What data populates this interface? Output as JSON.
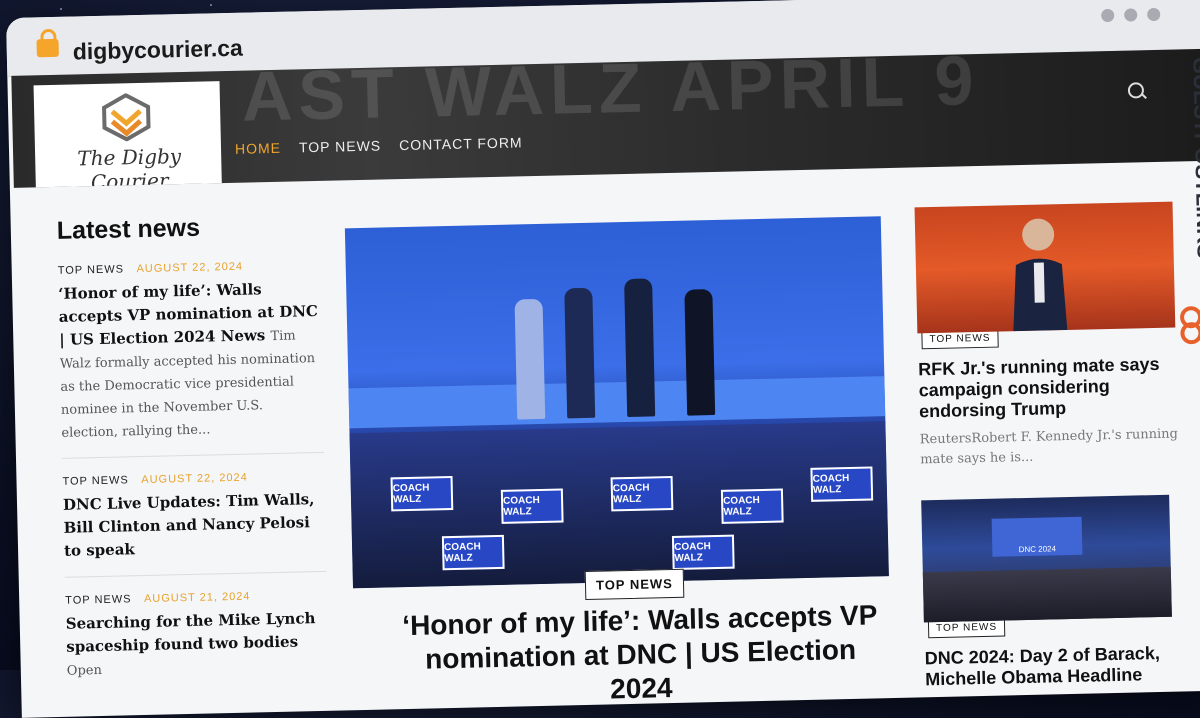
{
  "browser": {
    "url": "digbycourier.ca"
  },
  "header": {
    "logo_text": "The Digby Courier",
    "banner_text": "AST WALZ APRIL 9",
    "nav": [
      {
        "label": "HOME",
        "active": true
      },
      {
        "label": "TOP NEWS",
        "active": false
      },
      {
        "label": "CONTACT FORM",
        "active": false
      }
    ]
  },
  "latest": {
    "title": "Latest news",
    "items": [
      {
        "category": "TOP NEWS",
        "date": "AUGUST 22, 2024",
        "title": "‘Honor of my life’: Walls accepts VP nomination at DNC | US Election 2024 News",
        "excerpt": "Tim Walz formally accepted his nomination as the Democratic vice presidential nominee in the November U.S. election, rallying the..."
      },
      {
        "category": "TOP NEWS",
        "date": "AUGUST 22, 2024",
        "title": "DNC Live Updates: Tim Walls, Bill Clinton and Nancy Pelosi to speak",
        "excerpt": ""
      },
      {
        "category": "TOP NEWS",
        "date": "AUGUST 21, 2024",
        "title": "Searching for the Mike Lynch spaceship found two bodies",
        "excerpt": "Open"
      }
    ]
  },
  "hero": {
    "category": "TOP NEWS",
    "title": "‘Honor of my life’: Walls accepts VP nomination at DNC | US Election 2024",
    "sign_text": "COACH WALZ"
  },
  "side": [
    {
      "category": "TOP NEWS",
      "title": "RFK Jr.'s running mate says campaign considering endorsing Trump",
      "excerpt": "ReutersRobert F. Kennedy Jr.'s running mate says he is..."
    },
    {
      "category": "TOP NEWS",
      "title": "DNC 2024: Day 2 of Barack, Michelle Obama Headline",
      "screen_text": "DNC 2024"
    }
  ],
  "watermark": "GUESTPOSTLINKS",
  "colors": {
    "accent": "#e8a22d",
    "nav_active": "#f0a52c",
    "header_bg": "#2a2a2a"
  }
}
